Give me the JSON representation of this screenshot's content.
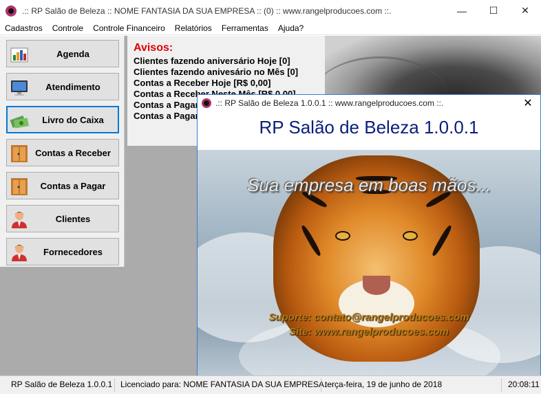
{
  "window": {
    "title": ".:: RP Salão de Beleza :: NOME FANTASIA DA SUA EMPRESA :: (0)  :: www.rangelproducoes.com ::.",
    "minimize": "—",
    "maximize": "☐",
    "close": "✕"
  },
  "menu": [
    "Cadastros",
    "Controle",
    "Controle Financeiro",
    "Relatórios",
    "Ferramentas",
    "Ajuda?"
  ],
  "nav": [
    {
      "label": "Agenda",
      "icon": "chart-icon"
    },
    {
      "label": "Atendimento",
      "icon": "monitor-icon"
    },
    {
      "label": "Livro do Caixa",
      "icon": "money-icon"
    },
    {
      "label": "Contas a Receber",
      "icon": "door-icon"
    },
    {
      "label": "Contas a Pagar",
      "icon": "door-icon"
    },
    {
      "label": "Clientes",
      "icon": "person-icon"
    },
    {
      "label": "Fornecedores",
      "icon": "person-icon"
    }
  ],
  "avisos": {
    "title": "Avisos:",
    "lines": [
      "Clientes fazendo aniversário Hoje [0]",
      "Clientes fazendo anivesário no Mês [0]",
      "Contas a Receber Hoje [R$ 0,00]",
      "Contas a Receber Neste Mês [R$ 0,00]",
      "Contas a Pagar",
      "Contas a Pagar"
    ]
  },
  "splash": {
    "title": ".:: RP Salão de Beleza 1.0.0.1 :: www.rangelproducoes.com ::.",
    "close": "✕",
    "heading": "RP Salão de Beleza 1.0.0.1",
    "slogan": "Sua empresa em boas mãos...",
    "support": "Suporte: contato@rangelproducoes.com",
    "site": "Site: www.rangelproducoes.com"
  },
  "status": {
    "app": "RP Salão de Beleza 1.0.0.1",
    "license": "Licenciado para: NOME FANTASIA DA SUA EMPRESA.",
    "date": "terça-feira, 19 de junho de 2018",
    "time": "20:08:11"
  },
  "colors": {
    "accent": "#0078d7",
    "avisos_title": "#e00000",
    "splash_heading": "#0a1e7a"
  }
}
